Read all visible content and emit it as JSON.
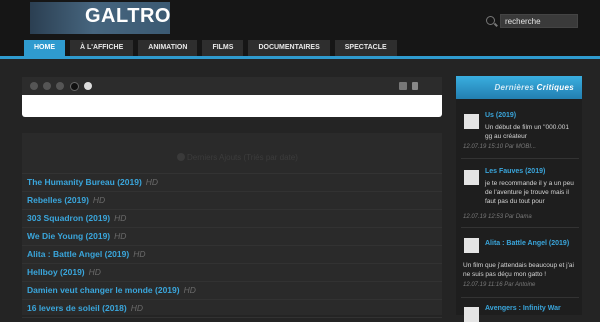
{
  "header": {
    "logo_text": "GALTRO",
    "search_placeholder": "recherche"
  },
  "nav": {
    "tabs": [
      "HOME",
      "À L'AFFICHE",
      "ANIMATION",
      "FILMS",
      "DOCUMENTAIRES",
      "SPECTACLE"
    ]
  },
  "main": {
    "header_text": "Derniers Ajouts (Triés par date)",
    "movies": [
      {
        "title": "The Humanity Bureau (2019)",
        "quality": "HD"
      },
      {
        "title": "Rebelles (2019)",
        "quality": "HD"
      },
      {
        "title": "303 Squadron (2019)",
        "quality": "HD"
      },
      {
        "title": "We Die Young (2019)",
        "quality": "HD"
      },
      {
        "title": "Alita : Battle Angel (2019)",
        "quality": "HD"
      },
      {
        "title": "Hellboy (2019)",
        "quality": "HD"
      },
      {
        "title": "Damien veut changer le monde (2019)",
        "quality": "HD"
      },
      {
        "title": "16 levers de soleil (2018)",
        "quality": "HD"
      }
    ]
  },
  "sidebar": {
    "title_a": "Dernières",
    "title_b": "Critiques",
    "reviews": [
      {
        "title": "Us (2019)",
        "text": "Un début de film un \"000.001 gg au créateur",
        "meta": "12.07.19 15:10 Par MOBI..."
      },
      {
        "title": "Les Fauves (2019)",
        "text": "je te recommande il y a un peu de l'aventure je trouve mais il faut pas du tout pour",
        "meta": "12.07.19 12:53 Par Dama"
      },
      {
        "title": "Alita : Battle Angel (2019)",
        "text": "Un film que j'attendais beaucoup et j'ai ne suis pas déçu mon gatto !",
        "meta": "12.07.19 11:16 Par Antoine"
      },
      {
        "title": "Avengers : Infinity War",
        "text": "",
        "meta": ""
      }
    ]
  }
}
